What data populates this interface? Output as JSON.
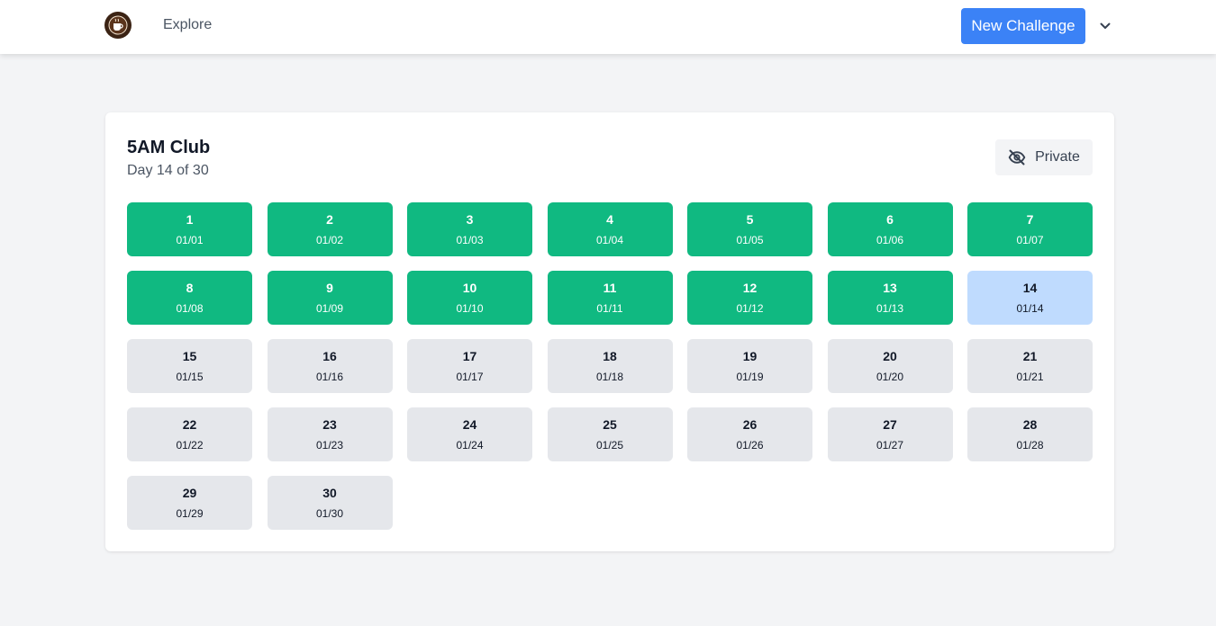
{
  "nav": {
    "explore": "Explore",
    "new_challenge": "New Challenge",
    "logo_icon": "coffee-cup-icon",
    "menu_icon": "chevron-down-icon"
  },
  "challenge": {
    "title": "5AM Club",
    "progress": "Day 14 of 30",
    "visibility": "Private",
    "visibility_icon": "eye-off-icon"
  },
  "colors": {
    "primary": "#3b82f6",
    "done": "#10b981",
    "current": "#bfdbfe",
    "upcoming": "#e5e7eb"
  },
  "days": [
    {
      "num": "1",
      "date": "01/01",
      "status": "done"
    },
    {
      "num": "2",
      "date": "01/02",
      "status": "done"
    },
    {
      "num": "3",
      "date": "01/03",
      "status": "done"
    },
    {
      "num": "4",
      "date": "01/04",
      "status": "done"
    },
    {
      "num": "5",
      "date": "01/05",
      "status": "done"
    },
    {
      "num": "6",
      "date": "01/06",
      "status": "done"
    },
    {
      "num": "7",
      "date": "01/07",
      "status": "done"
    },
    {
      "num": "8",
      "date": "01/08",
      "status": "done"
    },
    {
      "num": "9",
      "date": "01/09",
      "status": "done"
    },
    {
      "num": "10",
      "date": "01/10",
      "status": "done"
    },
    {
      "num": "11",
      "date": "01/11",
      "status": "done"
    },
    {
      "num": "12",
      "date": "01/12",
      "status": "done"
    },
    {
      "num": "13",
      "date": "01/13",
      "status": "done"
    },
    {
      "num": "14",
      "date": "01/14",
      "status": "current"
    },
    {
      "num": "15",
      "date": "01/15",
      "status": "upcoming"
    },
    {
      "num": "16",
      "date": "01/16",
      "status": "upcoming"
    },
    {
      "num": "17",
      "date": "01/17",
      "status": "upcoming"
    },
    {
      "num": "18",
      "date": "01/18",
      "status": "upcoming"
    },
    {
      "num": "19",
      "date": "01/19",
      "status": "upcoming"
    },
    {
      "num": "20",
      "date": "01/20",
      "status": "upcoming"
    },
    {
      "num": "21",
      "date": "01/21",
      "status": "upcoming"
    },
    {
      "num": "22",
      "date": "01/22",
      "status": "upcoming"
    },
    {
      "num": "23",
      "date": "01/23",
      "status": "upcoming"
    },
    {
      "num": "24",
      "date": "01/24",
      "status": "upcoming"
    },
    {
      "num": "25",
      "date": "01/25",
      "status": "upcoming"
    },
    {
      "num": "26",
      "date": "01/26",
      "status": "upcoming"
    },
    {
      "num": "27",
      "date": "01/27",
      "status": "upcoming"
    },
    {
      "num": "28",
      "date": "01/28",
      "status": "upcoming"
    },
    {
      "num": "29",
      "date": "01/29",
      "status": "upcoming"
    },
    {
      "num": "30",
      "date": "01/30",
      "status": "upcoming"
    }
  ]
}
